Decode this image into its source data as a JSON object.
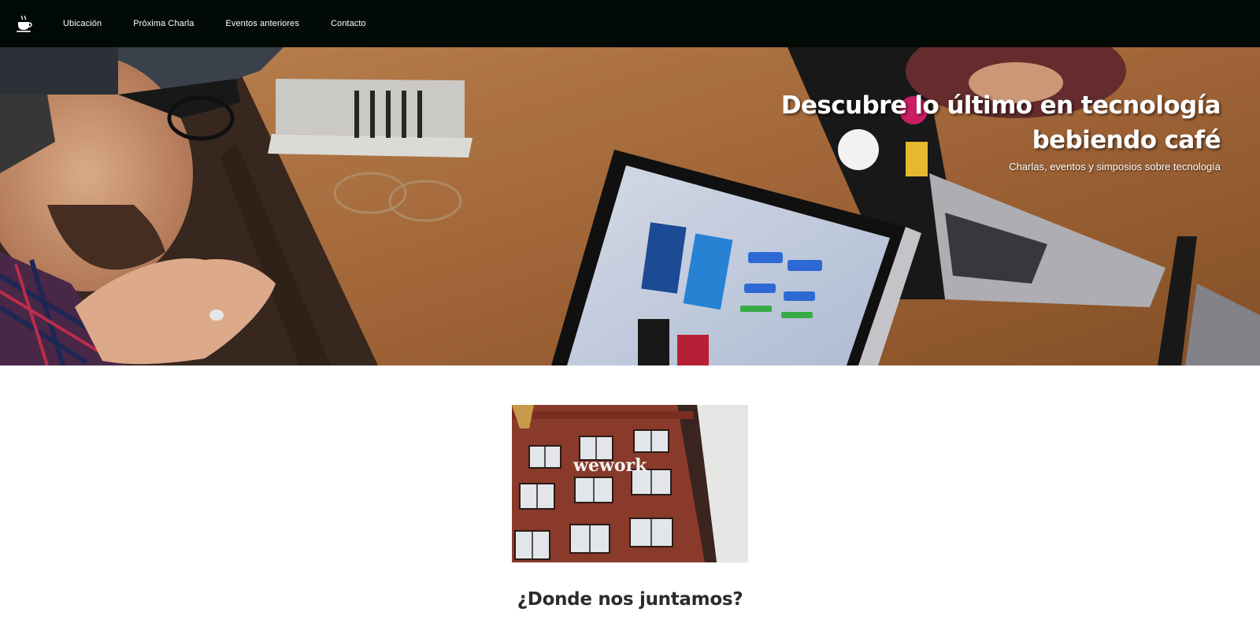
{
  "nav": {
    "logo_icon": "coffee-cup-icon",
    "links": [
      "Ubicación",
      "Próxima Charla",
      "Eventos anteriores",
      "Contacto"
    ]
  },
  "hero": {
    "title_line1": "Descubre lo último en tecnología",
    "title_line2": "bebiendo café",
    "subtitle": "Charlas, eventos y simposios sobre tecnología"
  },
  "location": {
    "building_sign": "wework",
    "heading": "¿Donde nos juntamos?"
  },
  "colors": {
    "navbar": "#020a06",
    "heading": "#2b2b2b",
    "text_light": "#ffffff"
  }
}
